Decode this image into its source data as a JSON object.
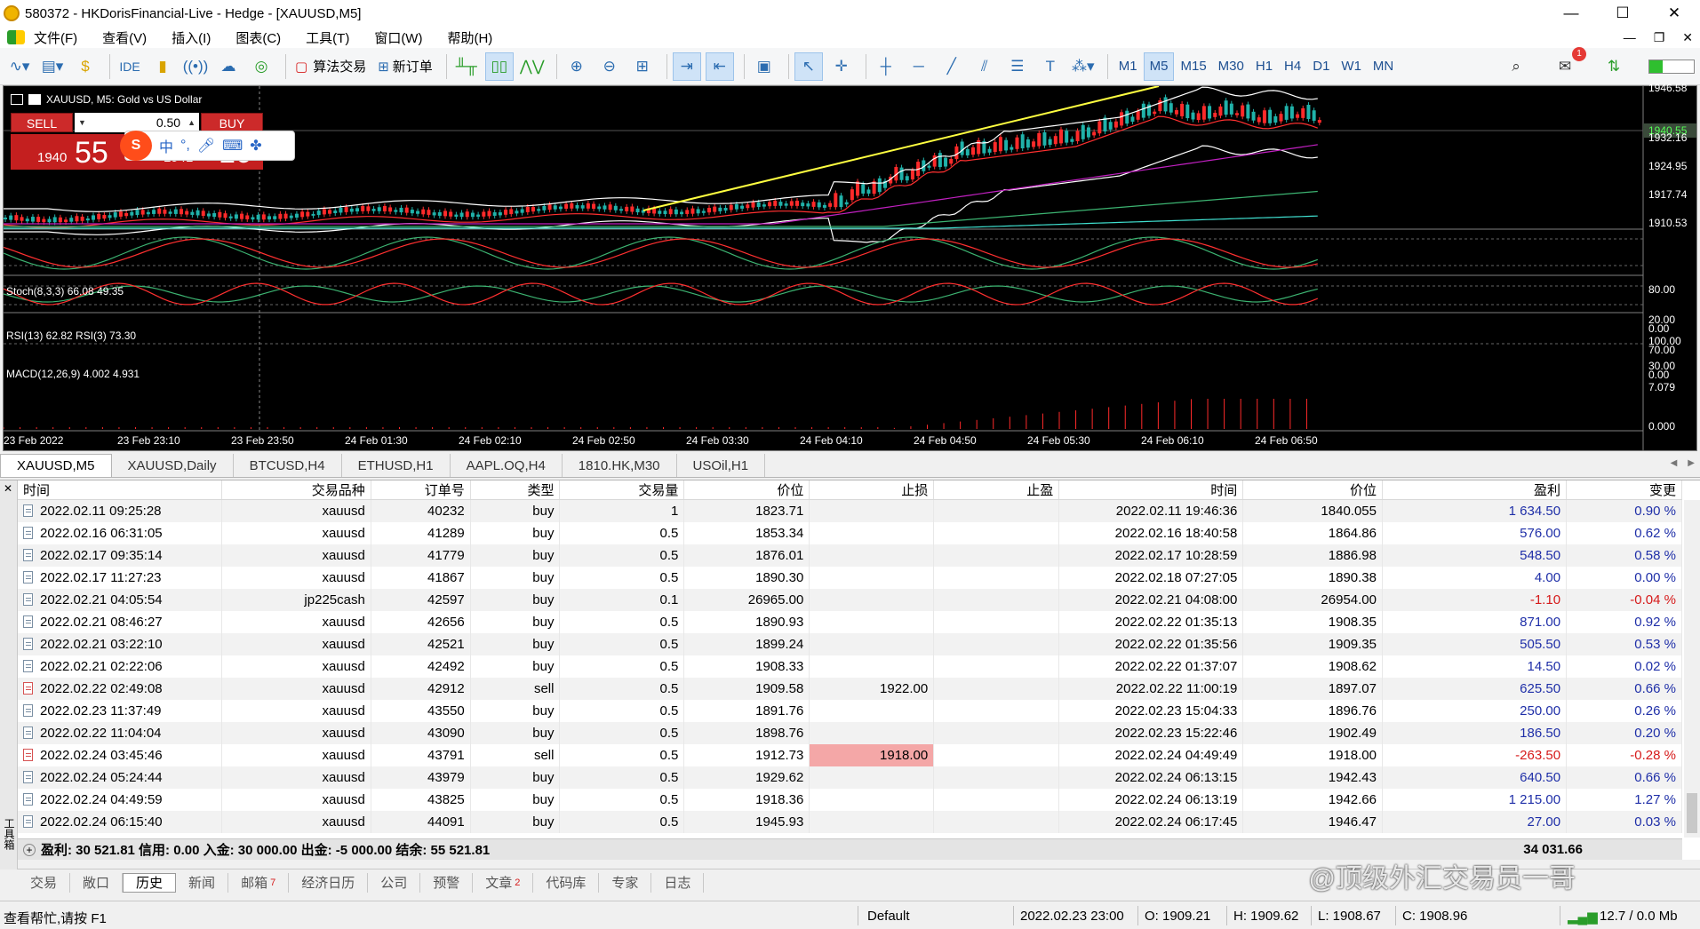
{
  "window": {
    "title": "580372 - HKDorisFinancial-Live - Hedge - [XAUUSD,M5]",
    "controls": [
      "—",
      "☐",
      "✕"
    ]
  },
  "menu": [
    "文件(F)",
    "查看(V)",
    "插入(I)",
    "图表(C)",
    "工具(T)",
    "窗口(W)",
    "帮助(H)"
  ],
  "toolbar": {
    "ide": "IDE",
    "algo_trading": "算法交易",
    "new_order": "新订单",
    "timeframes": [
      "M1",
      "M5",
      "M15",
      "M30",
      "H1",
      "H4",
      "D1",
      "W1",
      "MN"
    ],
    "active_timeframe": "M5",
    "alerts_count": "1"
  },
  "chart": {
    "symbol_info": "XAUUSD, M5:  Gold vs US Dollar",
    "sell_label": "SELL",
    "buy_label": "BUY",
    "lot": "0.50",
    "sell_price_small": "1940",
    "sell_price_big": "55",
    "buy_price_small": "1941",
    "buy_price_big": "10",
    "current_price": "1940.55",
    "price_ticks": [
      "1946.58",
      "1932.16",
      "1924.95",
      "1917.74",
      "1910.53"
    ],
    "stoch_label": "Stoch(8,3,3) 66.08 49.35",
    "stoch_ticks": [
      "80.00",
      "20.00",
      "0.00"
    ],
    "rsi_label": "RSI(13) 62.82 RSI(3) 73.30",
    "rsi_ticks": [
      "100.00",
      "70.00",
      "30.00",
      "0.00"
    ],
    "macd_label": "MACD(12,26,9) 4.002 4.931",
    "macd_ticks": [
      "7.079",
      "0.000"
    ],
    "time_ticks": [
      "23 Feb 2022",
      "23 Feb 23:10",
      "23 Feb 23:50",
      "24 Feb 01:30",
      "24 Feb 02:10",
      "24 Feb 02:50",
      "24 Feb 03:30",
      "24 Feb 04:10",
      "24 Feb 04:50",
      "24 Feb 05:30",
      "24 Feb 06:10",
      "24 Feb 06:50"
    ]
  },
  "ime": {
    "logo": "S",
    "chinese": "中",
    "punct": "°,"
  },
  "symbol_tabs": [
    "XAUUSD,M5",
    "XAUUSD,Daily",
    "BTCUSD,H4",
    "ETHUSD,H1",
    "AAPL.OQ,H4",
    "1810.HK,M30",
    "USOil,H1"
  ],
  "history": {
    "headers": [
      "时间",
      "交易品种",
      "订单号",
      "类型",
      "交易量",
      "价位",
      "止损",
      "止盈",
      "时间",
      "价位",
      "盈利",
      "变更"
    ],
    "rows": [
      [
        "2022.02.11 09:25:28",
        "xauusd",
        "40232",
        "buy",
        "1",
        "1823.71",
        "",
        "",
        "2022.02.11 19:46:36",
        "1840.055",
        "1 634.50",
        "0.90 %"
      ],
      [
        "2022.02.16 06:31:05",
        "xauusd",
        "41289",
        "buy",
        "0.5",
        "1853.34",
        "",
        "",
        "2022.02.16 18:40:58",
        "1864.86",
        "576.00",
        "0.62 %"
      ],
      [
        "2022.02.17 09:35:14",
        "xauusd",
        "41779",
        "buy",
        "0.5",
        "1876.01",
        "",
        "",
        "2022.02.17 10:28:59",
        "1886.98",
        "548.50",
        "0.58 %"
      ],
      [
        "2022.02.17 11:27:23",
        "xauusd",
        "41867",
        "buy",
        "0.5",
        "1890.30",
        "",
        "",
        "2022.02.18 07:27:05",
        "1890.38",
        "4.00",
        "0.00 %"
      ],
      [
        "2022.02.21 04:05:54",
        "jp225cash",
        "42597",
        "buy",
        "0.1",
        "26965.00",
        "",
        "",
        "2022.02.21 04:08:00",
        "26954.00",
        "-1.10",
        "-0.04 %"
      ],
      [
        "2022.02.21 08:46:27",
        "xauusd",
        "42656",
        "buy",
        "0.5",
        "1890.93",
        "",
        "",
        "2022.02.22 01:35:13",
        "1908.35",
        "871.00",
        "0.92 %"
      ],
      [
        "2022.02.21 03:22:10",
        "xauusd",
        "42521",
        "buy",
        "0.5",
        "1899.24",
        "",
        "",
        "2022.02.22 01:35:56",
        "1909.35",
        "505.50",
        "0.53 %"
      ],
      [
        "2022.02.21 02:22:06",
        "xauusd",
        "42492",
        "buy",
        "0.5",
        "1908.33",
        "",
        "",
        "2022.02.22 01:37:07",
        "1908.62",
        "14.50",
        "0.02 %"
      ],
      [
        "2022.02.22 02:49:08",
        "xauusd",
        "42912",
        "sell",
        "0.5",
        "1909.58",
        "1922.00",
        "",
        "2022.02.22 11:00:19",
        "1897.07",
        "625.50",
        "0.66 %"
      ],
      [
        "2022.02.23 11:37:49",
        "xauusd",
        "43550",
        "buy",
        "0.5",
        "1891.76",
        "",
        "",
        "2022.02.23 15:04:33",
        "1896.76",
        "250.00",
        "0.26 %"
      ],
      [
        "2022.02.22 11:04:04",
        "xauusd",
        "43090",
        "buy",
        "0.5",
        "1898.76",
        "",
        "",
        "2022.02.23 15:22:46",
        "1902.49",
        "186.50",
        "0.20 %"
      ],
      [
        "2022.02.24 03:45:46",
        "xauusd",
        "43791",
        "sell",
        "0.5",
        "1912.73",
        "1918.00",
        "",
        "2022.02.24 04:49:49",
        "1918.00",
        "-263.50",
        "-0.28 %"
      ],
      [
        "2022.02.24 05:24:44",
        "xauusd",
        "43979",
        "buy",
        "0.5",
        "1929.62",
        "",
        "",
        "2022.02.24 06:13:15",
        "1942.43",
        "640.50",
        "0.66 %"
      ],
      [
        "2022.02.24 04:49:59",
        "xauusd",
        "43825",
        "buy",
        "0.5",
        "1918.36",
        "",
        "",
        "2022.02.24 06:13:19",
        "1942.66",
        "1 215.00",
        "1.27 %"
      ],
      [
        "2022.02.24 06:15:40",
        "xauusd",
        "44091",
        "buy",
        "0.5",
        "1945.93",
        "",
        "",
        "2022.02.24 06:17:45",
        "1946.47",
        "27.00",
        "0.03 %"
      ]
    ],
    "summary": "盈利: 30 521.81  信用: 0.00  入金: 30 000.00  出金: -5 000.00  结余: 55 521.81",
    "total_profit": "34 031.66"
  },
  "terminal_side_label": "工具箱",
  "bottom_tabs": [
    "交易",
    "敞口",
    "历史",
    "新闻",
    "邮箱",
    "经济日历",
    "公司",
    "预警",
    "文章",
    "代码库",
    "专家",
    "日志"
  ],
  "bottom_tab_badges": {
    "邮箱": "7",
    "文章": "2"
  },
  "active_bottom_tab": "历史",
  "watermark": "@顶级外汇交易员一哥",
  "status": {
    "help": "查看帮忙,请按 F1",
    "profile": "Default",
    "datetime": "2022.02.23 23:00",
    "open": "O: 1909.21",
    "high": "H: 1909.62",
    "low": "L: 1908.67",
    "close": "C: 1908.96",
    "traffic": "12.7 / 0.0 Mb"
  },
  "colors": {
    "sell_btn": "#cc2a2a",
    "profit_blue": "#1f2fa8",
    "loss_red": "#d61a1a",
    "highlight": "#f4a7a7"
  }
}
